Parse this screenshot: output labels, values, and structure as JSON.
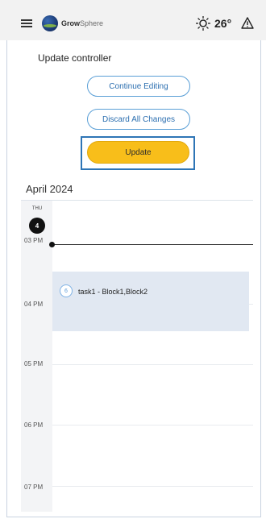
{
  "header": {
    "brand_bold": "Grow",
    "brand_light": "Sphere",
    "temperature": "26°",
    "icons": [
      "hamburger-icon",
      "logo-icon",
      "sun-icon",
      "alert-icon"
    ]
  },
  "panel": {
    "title": "Update controller",
    "continue_label": "Continue Editing",
    "discard_label": "Discard All Changes",
    "update_label": "Update"
  },
  "calendar": {
    "month": "April 2024",
    "day_name": "THU",
    "day_number": "4",
    "hours": [
      "03 PM",
      "04 PM",
      "05 PM",
      "06 PM",
      "07 PM"
    ],
    "event": {
      "index": "6",
      "text": "task1 -  Block1,Block2"
    }
  },
  "colors": {
    "accent": "#5a9fd6",
    "update": "#f8be1a",
    "focus": "#2e75b6",
    "event_bg": "#e1e8f2"
  }
}
